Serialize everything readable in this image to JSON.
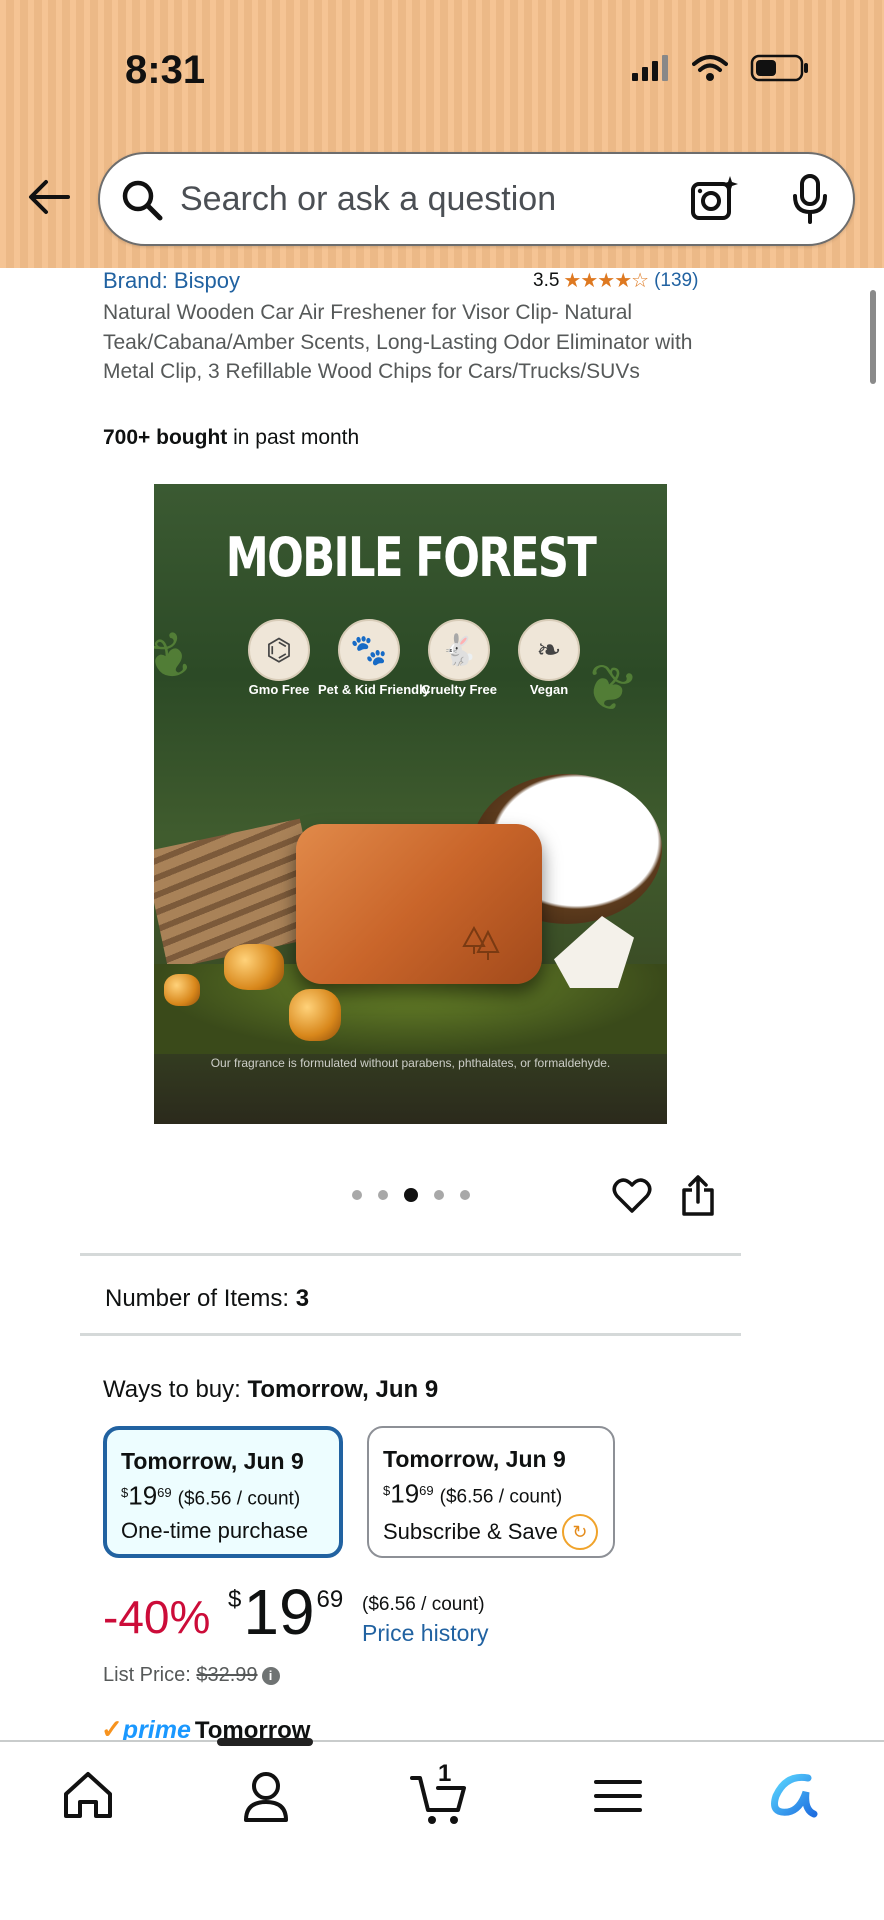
{
  "status_bar": {
    "time": "8:31"
  },
  "search": {
    "placeholder": "Search or ask a question"
  },
  "product": {
    "brand": "Brand: Bispoy",
    "rating_value": "3.5",
    "stars": "★★★★☆",
    "rating_count": "(139)",
    "title": "Natural Wooden Car Air Freshener for Visor Clip- Natural Teak/Cabana/Amber Scents, Long-Lasting Odor Eliminator with Metal Clip, 3 Refillable Wood Chips for Cars/Trucks/SUVs",
    "bought_bold": "700+ bought",
    "bought_rest": " in past month"
  },
  "image": {
    "headline": "MOBILE FOREST",
    "badges": [
      "Gmo Free",
      "Pet & Kid Friendly",
      "Cruelty Free",
      "Vegan"
    ],
    "footnote": "Our fragrance is formulated without parabens, phthalates, or formaldehyde."
  },
  "carousel": {
    "total": 5,
    "active": 3
  },
  "items": {
    "label": "Number of Items: ",
    "value": "3"
  },
  "ways_to_buy": {
    "label": "Ways to buy: ",
    "date": "Tomorrow, Jun 9",
    "options": [
      {
        "date": "Tomorrow, Jun 9",
        "currency": "$",
        "whole": "19",
        "cents": "69",
        "unit": "($6.56 / count)",
        "type": "One-time purchase",
        "selected": true
      },
      {
        "date": "Tomorrow, Jun 9",
        "currency": "$",
        "whole": "19",
        "cents": "69",
        "unit": "($6.56 / count)",
        "type": "Subscribe & Save",
        "selected": false
      }
    ]
  },
  "pricing": {
    "discount": "-40%",
    "currency": "$",
    "whole": "19",
    "cents": "69",
    "unit_price": "($6.56 / count)",
    "price_history": "Price history",
    "list_price_label": "List Price: ",
    "list_price": "$32.99"
  },
  "delivery": {
    "check": "✓",
    "prime": "prime",
    "when": "Tomorrow"
  },
  "nav": {
    "cart_count": "1"
  },
  "colors": {
    "header": "#f4bf8b",
    "link": "#2162a1",
    "discount": "#cc0c39",
    "star": "#de7921",
    "prime": "#1a98ff"
  }
}
